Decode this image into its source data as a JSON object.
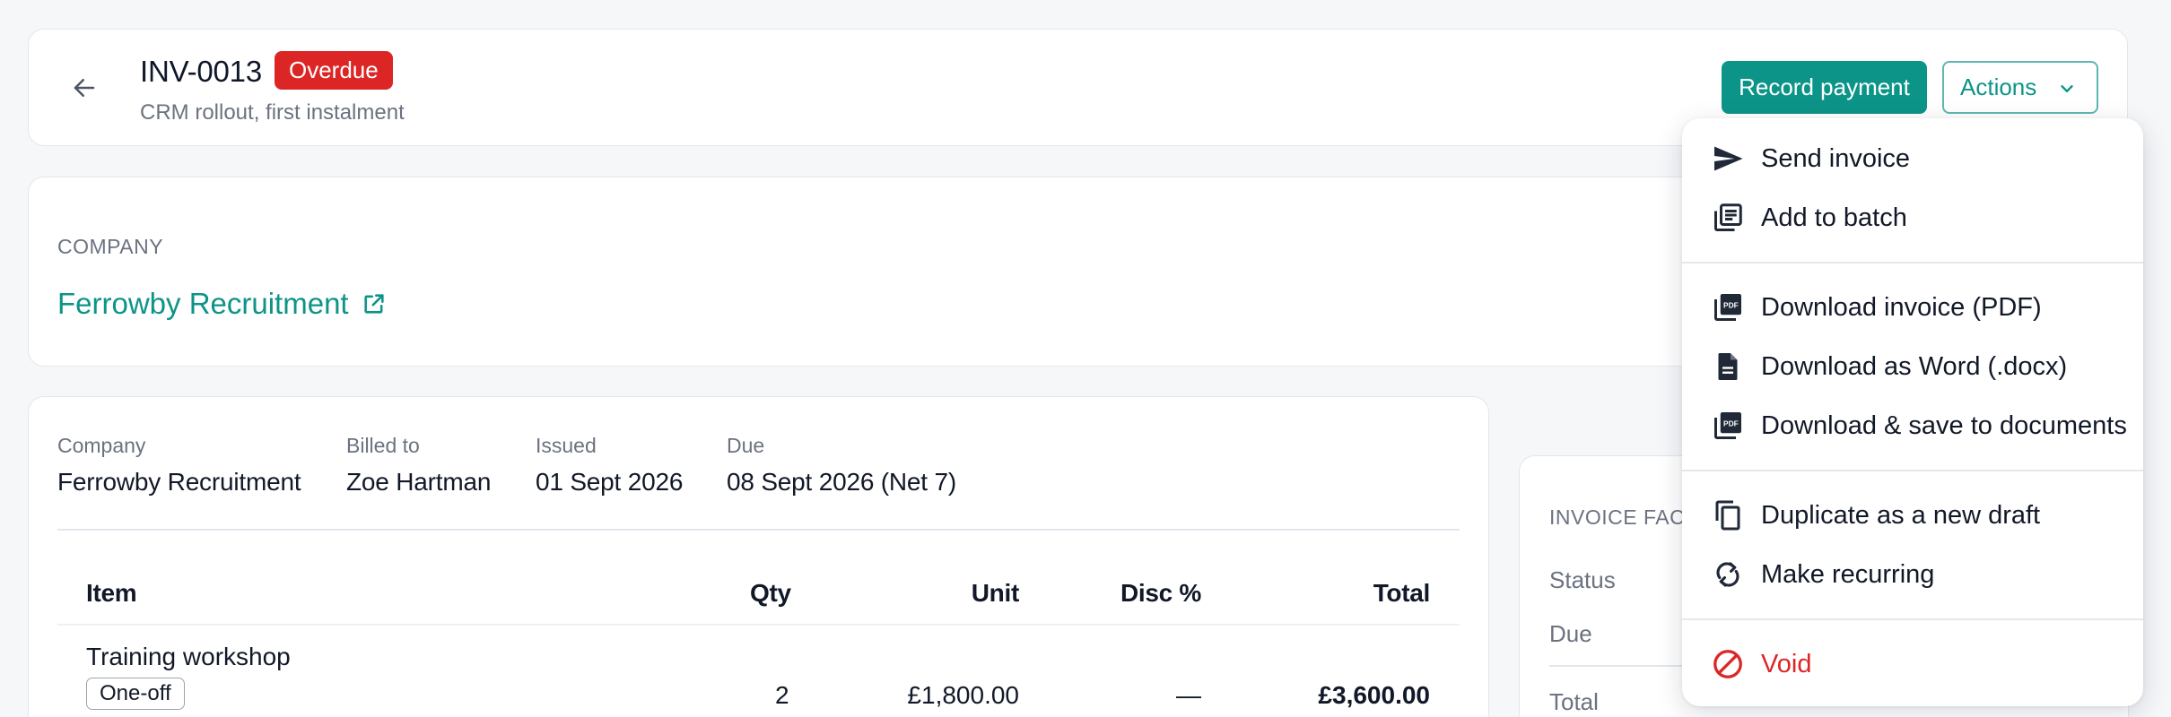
{
  "header": {
    "invoice_number": "INV-0013",
    "status_badge": "Overdue",
    "subtitle": "CRM rollout, first instalment",
    "record_payment_label": "Record payment",
    "actions_label": "Actions"
  },
  "company_section": {
    "label": "COMPANY",
    "company_name": "Ferrowby Recruitment"
  },
  "invoice_meta": {
    "company": {
      "label": "Company",
      "value": "Ferrowby Recruitment"
    },
    "billed_to": {
      "label": "Billed to",
      "value": "Zoe Hartman"
    },
    "issued": {
      "label": "Issued",
      "value": "01 Sept 2026"
    },
    "due": {
      "label": "Due",
      "value": "08 Sept 2026 (Net 7)"
    }
  },
  "line_items": {
    "columns": [
      "Item",
      "Qty",
      "Unit",
      "Disc %",
      "Total"
    ],
    "rows": [
      {
        "item": "Training workshop",
        "tag": "One-off",
        "qty": "2",
        "unit": "£1,800.00",
        "disc": "—",
        "total": "£3,600.00"
      }
    ]
  },
  "invoice_facts": {
    "title": "INVOICE FAC",
    "status_label": "Status",
    "due_label": "Due",
    "total_label": "Total"
  },
  "actions_menu": {
    "items": [
      {
        "label": "Send invoice",
        "icon": "send-icon"
      },
      {
        "label": "Add to batch",
        "icon": "batch-icon"
      },
      {
        "label": "Download invoice (PDF)",
        "icon": "pdf-icon"
      },
      {
        "label": "Download as Word (.docx)",
        "icon": "document-icon"
      },
      {
        "label": "Download & save to documents",
        "icon": "pdf-icon"
      },
      {
        "label": "Duplicate as a new draft",
        "icon": "duplicate-icon"
      },
      {
        "label": "Make recurring",
        "icon": "recurring-icon"
      },
      {
        "label": "Void",
        "icon": "void-icon"
      }
    ]
  },
  "colors": {
    "accent": "#0d9488",
    "danger": "#dc2626",
    "muted_text": "#6b7280"
  }
}
